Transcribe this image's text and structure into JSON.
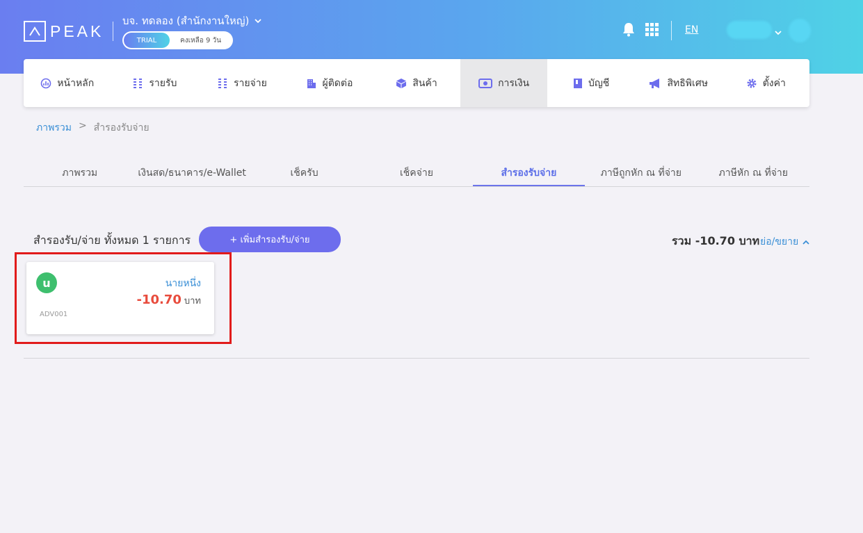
{
  "header": {
    "logo_text": "PEAK",
    "company": "บจ. ทดลอง (สำนักงานใหญ่)",
    "trial_label": "TRIAL",
    "trial_remaining": "คงเหลือ 9 วัน",
    "language": "EN"
  },
  "nav": {
    "items": [
      {
        "label": "หน้าหลัก",
        "icon": "dashboard-icon"
      },
      {
        "label": "รายรับ",
        "icon": "coins-icon"
      },
      {
        "label": "รายจ่าย",
        "icon": "coins-icon"
      },
      {
        "label": "ผู้ติดต่อ",
        "icon": "building-icon"
      },
      {
        "label": "สินค้า",
        "icon": "box-icon"
      },
      {
        "label": "การเงิน",
        "icon": "money-icon"
      },
      {
        "label": "บัญชี",
        "icon": "ledger-icon"
      },
      {
        "label": "สิทธิพิเศษ",
        "icon": "megaphone-icon"
      },
      {
        "label": "ตั้งค่า",
        "icon": "gear-icon"
      }
    ],
    "active_index": 5
  },
  "breadcrumb": {
    "root": "ภาพรวม",
    "separator": ">",
    "current": "สำรองรับจ่าย"
  },
  "subtabs": [
    "ภาพรวม",
    "เงินสด/ธนาคาร/e-Wallet",
    "เช็ครับ",
    "เช็คจ่าย",
    "สำรองรับจ่าย",
    "ภาษีถูกหัก ณ ที่จ่าย",
    "ภาษีหัก ณ ที่จ่าย"
  ],
  "active_subtab": 4,
  "list": {
    "title": "สำรองรับ/จ่าย ทั้งหมด 1 รายการ",
    "add_button": "+ เพิ่มสำรองรับ/จ่าย",
    "total": "รวม -10.70 บาท",
    "collapse_label": "ย่อ/ขยาย"
  },
  "card": {
    "avatar_letter": "u",
    "name": "นายหนึ่ง",
    "amount": "-10.70",
    "currency": "บาท",
    "code": "ADV001"
  },
  "colors": {
    "accent": "#6d6ded",
    "link": "#3a8fd6",
    "negative": "#e84c3d",
    "avatar": "#3ebf6e",
    "highlight": "#e11b1b"
  }
}
